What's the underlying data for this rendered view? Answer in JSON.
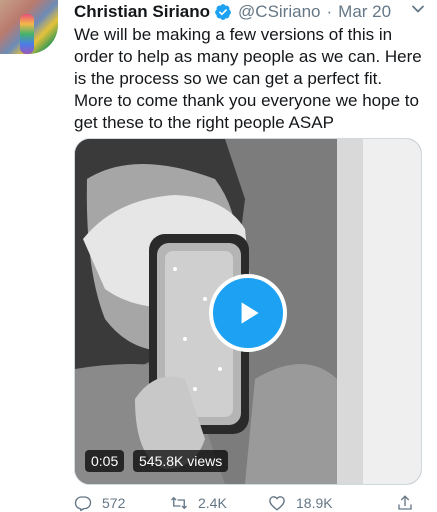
{
  "tweet": {
    "author_name": "Christian Siriano",
    "handle": "@CSiriano",
    "separator": "·",
    "date": "Mar 20",
    "text_lines": [
      "We will be making a few versions of this in",
      "order to help as many people as we can. Here",
      "is the process so we can get a perfect fit.",
      "More to come thank you everyone we hope to",
      "get these to the right people ASAP"
    ]
  },
  "video": {
    "duration": "0:05",
    "views": "545.8K views"
  },
  "actions": {
    "replies": "572",
    "retweets": "2.4K",
    "likes": "18.9K"
  },
  "icons": {
    "verified": "verified-badge-icon",
    "more": "chevron-down-icon",
    "play": "play-icon",
    "reply": "reply-icon",
    "retweet": "retweet-icon",
    "like": "heart-icon",
    "share": "share-icon"
  },
  "colors": {
    "accent": "#1da1f2",
    "secondary_text": "#657786"
  }
}
